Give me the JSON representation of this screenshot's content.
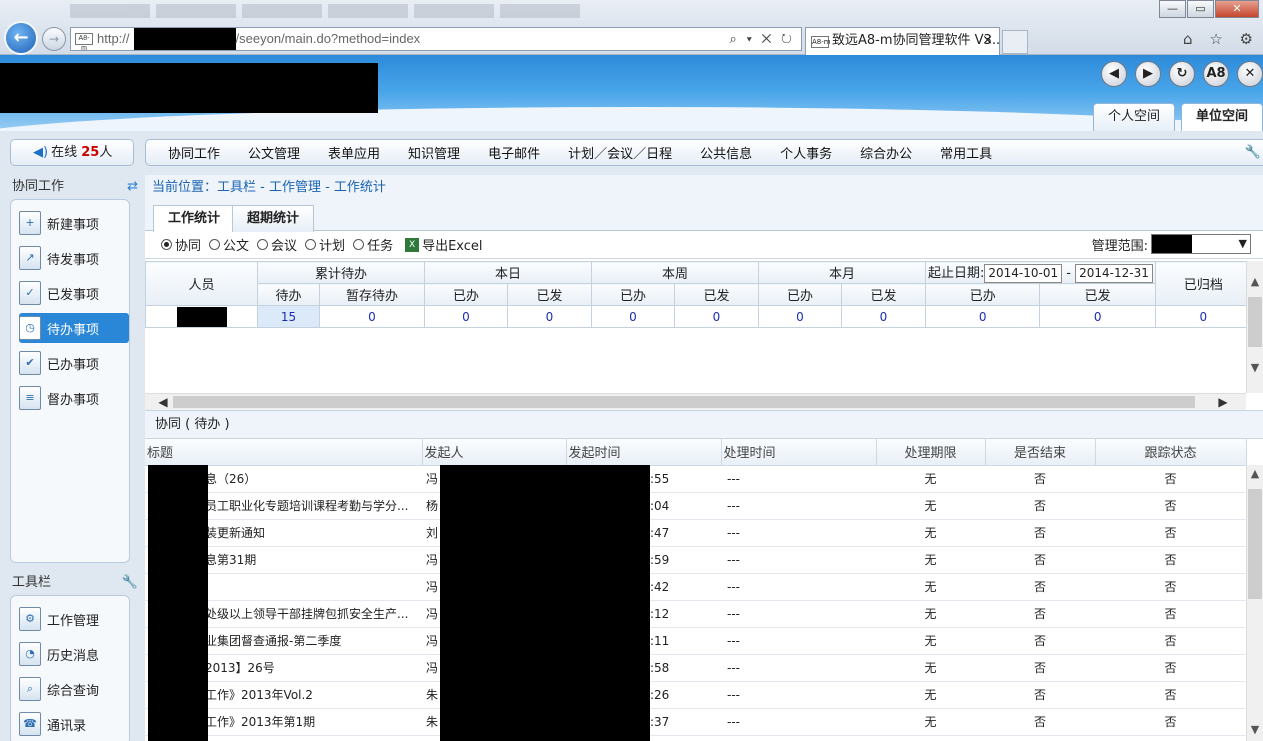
{
  "browser": {
    "url_prefix": "http://",
    "url_suffix": "/seeyon/main.do?method=index",
    "tab_title": "致远A8-m协同管理软件 V3...",
    "tab_close": "×",
    "favicon": "A8-m",
    "addr_icons": "⌕ ▾ ✕ ↻",
    "right_icons": "⌂ ☆ ⚙",
    "win": {
      "minimize": "—",
      "maximize": "▭",
      "close": "✕"
    },
    "back": "←",
    "forward": "→"
  },
  "header": {
    "icons": [
      "◀",
      "▶",
      "↻",
      "A8",
      "✕"
    ],
    "space_tabs": [
      "个人空间",
      "单位空间"
    ]
  },
  "online": {
    "label": "在线",
    "count": "25",
    "unit": "人",
    "icon": "◀)"
  },
  "menu": [
    "协同工作",
    "公文管理",
    "表单应用",
    "知识管理",
    "电子邮件",
    "计划／会议／日程",
    "公共信息",
    "个人事务",
    "综合办公",
    "常用工具"
  ],
  "sidebar": {
    "section1": "协同工作",
    "items": [
      {
        "label": "新建事项",
        "icon": "+"
      },
      {
        "label": "待发事项",
        "icon": "↗"
      },
      {
        "label": "已发事项",
        "icon": "✓"
      },
      {
        "label": "待办事项",
        "icon": "◷"
      },
      {
        "label": "已办事项",
        "icon": "✔"
      },
      {
        "label": "督办事项",
        "icon": "≡"
      }
    ],
    "section2": "工具栏",
    "tools": [
      {
        "label": "工作管理",
        "icon": "⚙"
      },
      {
        "label": "历史消息",
        "icon": "◔"
      },
      {
        "label": "综合查询",
        "icon": "⌕"
      },
      {
        "label": "通讯录",
        "icon": "☎"
      }
    ]
  },
  "breadcrumb": {
    "label": "当前位置：",
    "path": "工具栏 - 工作管理 - 工作统计"
  },
  "subtabs": [
    "工作统计",
    "超期统计"
  ],
  "filters": {
    "options": [
      "协同",
      "公文",
      "会议",
      "计划",
      "任务"
    ],
    "selected": "协同",
    "export": "导出Excel",
    "scope_label": "管理范围:"
  },
  "stats": {
    "person_header": "人员",
    "groups": [
      "累计待办",
      "本日",
      "本周",
      "本月"
    ],
    "date_label": "起止日期:",
    "date_from": "2014-10-01",
    "date_sep": "-",
    "date_to": "2014-12-31",
    "archived": "已归档",
    "sub": [
      "待办",
      "暂存待办",
      "已办",
      "已发",
      "已办",
      "已发",
      "已办",
      "已发",
      "已办",
      "已发"
    ],
    "row": [
      "15",
      "0",
      "0",
      "0",
      "0",
      "0",
      "0",
      "0",
      "0",
      "0",
      "0"
    ]
  },
  "list": {
    "title": "协同 ( 待办 )",
    "headers": [
      "标题",
      "发起人",
      "发起时间",
      "处理时间",
      "处理期限",
      "是否结束",
      "跟踪状态"
    ],
    "rows": [
      {
        "title": "息（26）",
        "sender": "冯",
        "time": ":55",
        "handled": "---",
        "limit": "无",
        "done": "否",
        "track": "否"
      },
      {
        "title": "员工职业化专题培训课程考勤与学分...",
        "sender": "杨",
        "time": ":04",
        "handled": "---",
        "limit": "无",
        "done": "否",
        "track": "否"
      },
      {
        "title": "装更新通知",
        "sender": "刘",
        "time": ":47",
        "handled": "---",
        "limit": "无",
        "done": "否",
        "track": "否"
      },
      {
        "title": "息第31期",
        "sender": "冯",
        "time": ":59",
        "handled": "---",
        "limit": "无",
        "done": "否",
        "track": "否"
      },
      {
        "title": "",
        "sender": "冯",
        "time": ":42",
        "handled": "---",
        "limit": "无",
        "done": "否",
        "track": "否"
      },
      {
        "title": "处级以上领导干部挂牌包抓安全生产...",
        "sender": "冯",
        "time": ":12",
        "handled": "---",
        "limit": "无",
        "done": "否",
        "track": "否"
      },
      {
        "title": "业集团督查通报-第二季度",
        "sender": "冯",
        "time": ":11",
        "handled": "---",
        "limit": "无",
        "done": "否",
        "track": "否"
      },
      {
        "title": "2013】26号",
        "sender": "冯",
        "time": ":58",
        "handled": "---",
        "limit": "无",
        "done": "否",
        "track": "否"
      },
      {
        "title": "工作》2013年Vol.2",
        "sender": "朱",
        "time": ":26",
        "handled": "---",
        "limit": "无",
        "done": "否",
        "track": "否"
      },
      {
        "title": "工作》2013年第1期",
        "sender": "朱",
        "time": ":37",
        "handled": "---",
        "limit": "无",
        "done": "否",
        "track": "否"
      }
    ]
  },
  "colors": {
    "accent": "#2a87d8",
    "link": "#1a63b3",
    "value": "#1a2fb0"
  }
}
